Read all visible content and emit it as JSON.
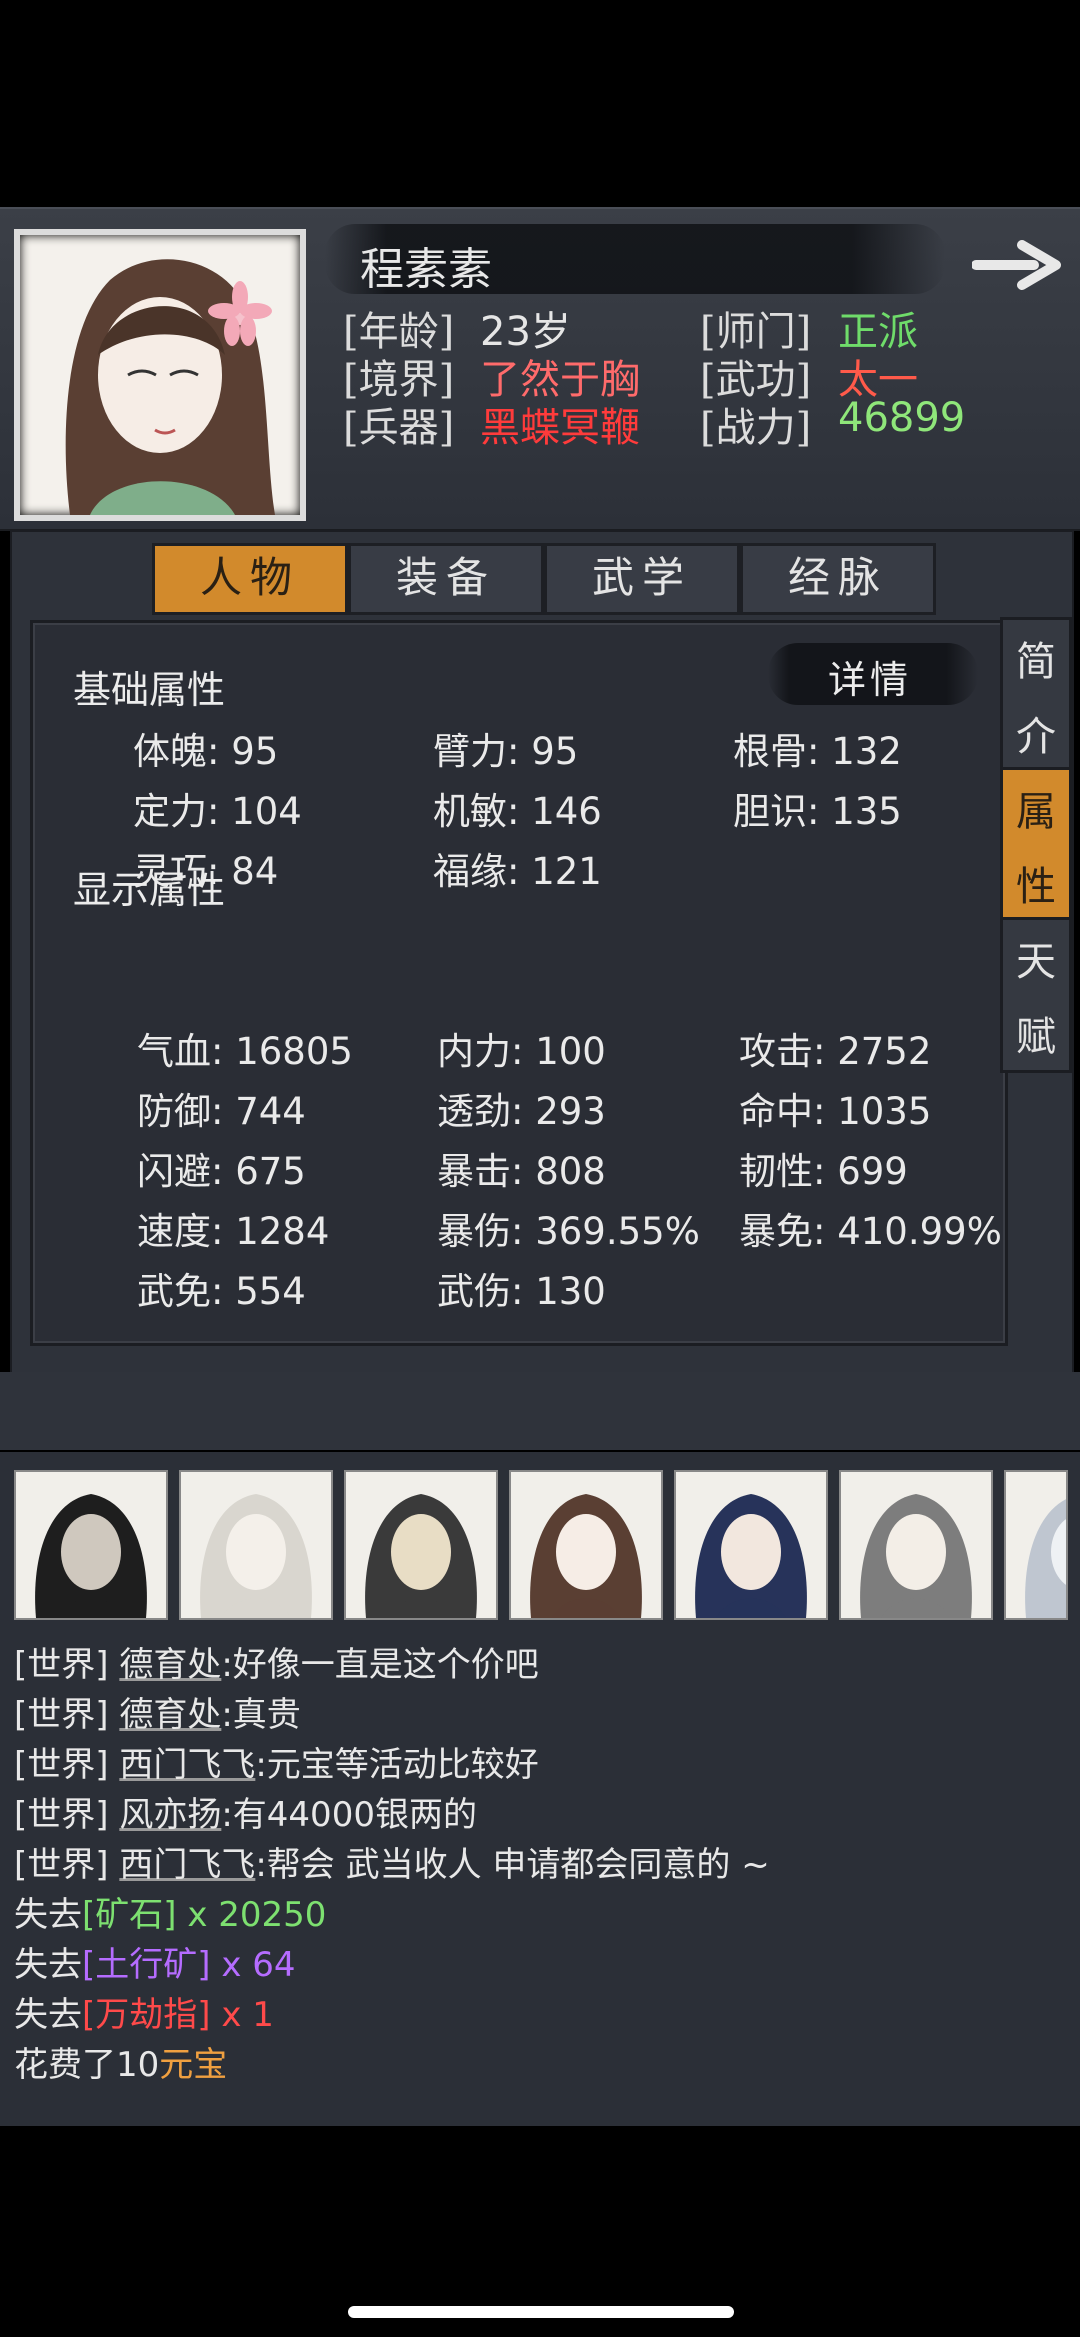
{
  "header": {
    "name": "程素素",
    "rows": [
      {
        "l_label": "[年龄]",
        "l_value": "23岁",
        "l_color": "#e6e6e6",
        "r_label": "[师门]",
        "r_value": "正派",
        "r_color": "#6fdc6a"
      },
      {
        "l_label": "[境界]",
        "l_value": "了然于胸",
        "l_color": "#ff6b6b",
        "r_label": "[武功]",
        "r_value": "太一",
        "r_color": "#ff5a4a"
      },
      {
        "l_label": "[兵器]",
        "l_value": "黑蝶冥鞭",
        "l_color": "#ff3b3b",
        "r_label": "[战力]",
        "r_value": "46899",
        "r_color": "#8fe67a"
      }
    ]
  },
  "tabs": [
    {
      "label": "人物",
      "active": true
    },
    {
      "label": "装备",
      "active": false
    },
    {
      "label": "武学",
      "active": false
    },
    {
      "label": "经脉",
      "active": false
    }
  ],
  "side_tabs": [
    {
      "c1": "简",
      "c2": "介",
      "active": false
    },
    {
      "c1": "属",
      "c2": "性",
      "active": true
    },
    {
      "c1": "天",
      "c2": "赋",
      "active": false
    }
  ],
  "detail_label": "详情",
  "base_section": {
    "title": "基础属性",
    "stats": [
      "体魄: 95",
      "臂力: 95",
      "根骨: 132",
      "定力: 104",
      "机敏: 146",
      "胆识: 135",
      "灵巧: 84",
      "福缘: 121"
    ]
  },
  "display_section": {
    "title": "显示属性",
    "stats": [
      "气血: 16805",
      "内力: 100",
      "攻击: 2752",
      "防御: 744",
      "透劲: 293",
      "命中: 1035",
      "闪避: 675",
      "暴击: 808",
      "韧性: 699",
      "速度: 1284",
      "暴伤: 369.55%",
      "暴免: 410.99%",
      "武免: 554",
      "武伤: 130"
    ]
  },
  "chat": {
    "lines": [
      {
        "prefix": "[世界] ",
        "speaker": "德育处",
        "text": ":好像一直是这个价吧"
      },
      {
        "prefix": "[世界] ",
        "speaker": "德育处",
        "text": ":真贵"
      },
      {
        "prefix": "[世界] ",
        "speaker": "西门飞飞",
        "text": ":元宝等活动比较好"
      },
      {
        "prefix": "[世界] ",
        "speaker": "风亦扬",
        "text": ":有44000银两的"
      },
      {
        "prefix": "[世界] ",
        "speaker": "西门飞飞",
        "text": ":帮会 武当收人 申请都会同意的 ~"
      }
    ],
    "losses": [
      {
        "prefix": "失去",
        "item": "[矿石]",
        "qty": " x 20250",
        "color": "#7de070"
      },
      {
        "prefix": "失去",
        "item": "[土行矿]",
        "qty": " x 64",
        "color": "#b56cff"
      },
      {
        "prefix": "失去",
        "item": "[万劫指]",
        "qty": " x 1",
        "color": "#ff4a4a"
      }
    ],
    "spent": {
      "prefix": "花费了10",
      "item": "元宝",
      "color": "#f0a040"
    }
  },
  "colors": {
    "accent": "#d28a2c",
    "panel": "#2e323a"
  }
}
